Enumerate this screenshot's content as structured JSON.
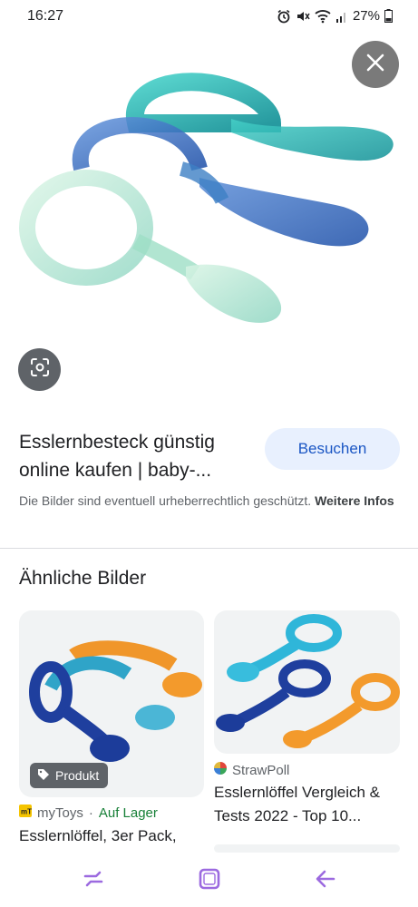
{
  "status_bar": {
    "time": "16:27",
    "battery": "27%",
    "icons": [
      "alarm-icon",
      "mute-icon",
      "wifi-icon",
      "signal-icon",
      "battery-icon"
    ]
  },
  "viewer": {
    "close_icon": "close-icon",
    "lens_icon": "lens-icon"
  },
  "result": {
    "title": "Esslernbesteck günstig online kaufen | baby-...",
    "visit_label": "Besuchen",
    "copyright_text": "Die Bilder sind eventuell urheberrechtlich geschützt.",
    "more_info_label": "Weitere Infos"
  },
  "similar": {
    "heading": "Ähnliche Bilder",
    "cards": [
      {
        "badge": "Produkt",
        "source": "myToys",
        "separator": "·",
        "availability": "Auf Lager",
        "title": "Esslernlöffel, 3er Pack,"
      },
      {
        "source": "StrawPoll",
        "title": "Esslernlöffel Vergleich & Tests 2022 - Top 10..."
      }
    ]
  },
  "nav": {
    "icons": [
      "recent-apps-icon",
      "home-icon",
      "back-icon"
    ]
  },
  "colors": {
    "accent": "#1a56c4",
    "button_bg": "#e8f0fe",
    "stock": "#188038",
    "nav": "#9c6ae0"
  }
}
